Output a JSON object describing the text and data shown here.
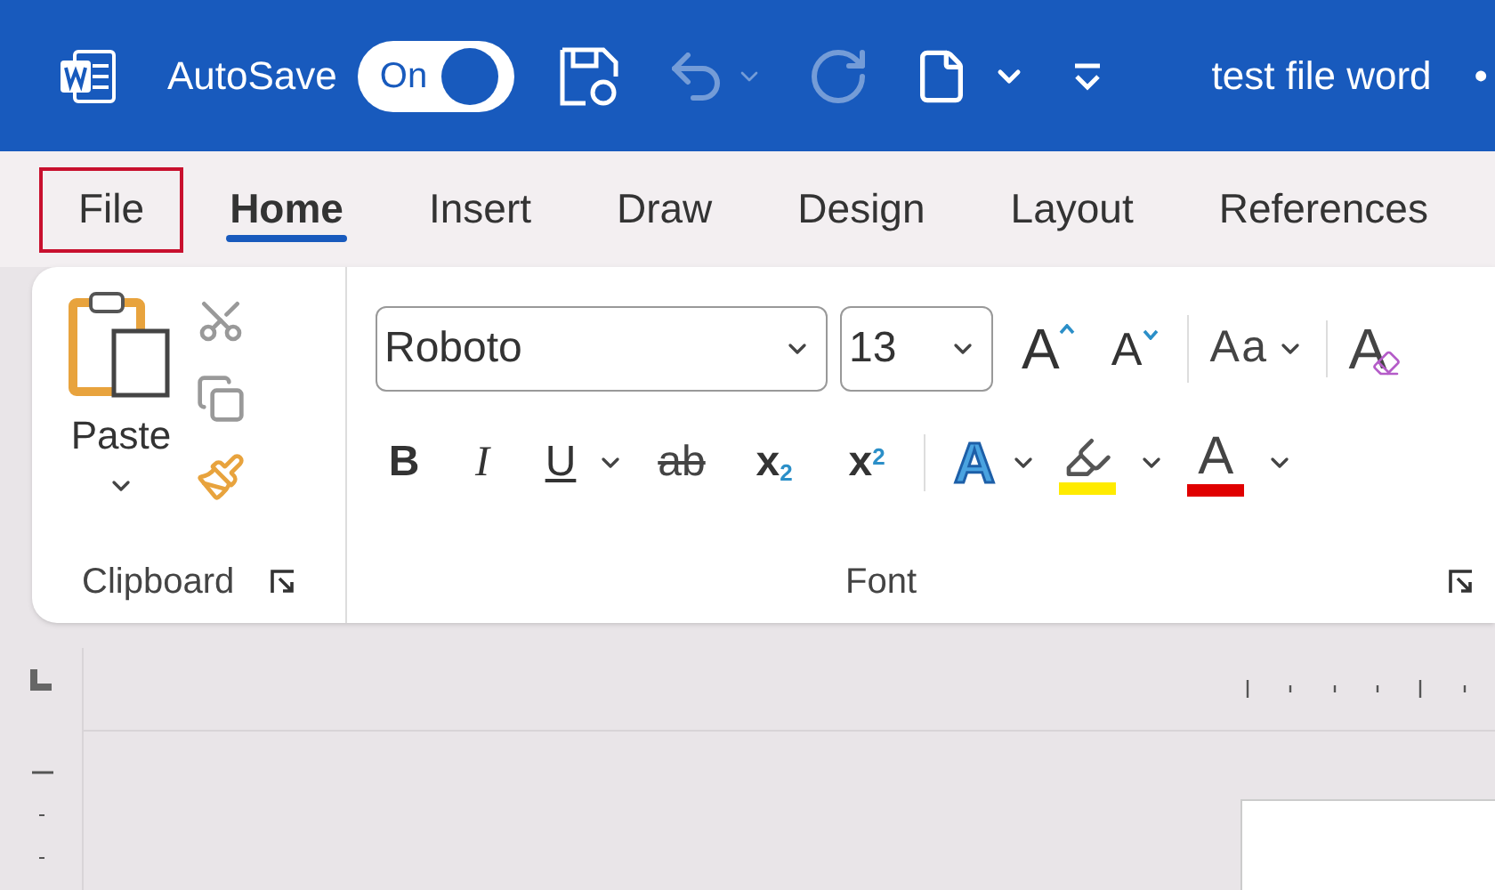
{
  "title_bar": {
    "autosave_label": "AutoSave",
    "autosave_on": true,
    "autosave_state": "On",
    "document_title": "test file word",
    "status_mark": "•"
  },
  "tabs": [
    {
      "label": "File",
      "selected": false,
      "highlighted": true
    },
    {
      "label": "Home",
      "selected": true,
      "highlighted": false
    },
    {
      "label": "Insert",
      "selected": false,
      "highlighted": false
    },
    {
      "label": "Draw",
      "selected": false,
      "highlighted": false
    },
    {
      "label": "Design",
      "selected": false,
      "highlighted": false
    },
    {
      "label": "Layout",
      "selected": false,
      "highlighted": false
    },
    {
      "label": "References",
      "selected": false,
      "highlighted": false
    }
  ],
  "clipboard": {
    "paste_label": "Paste",
    "group_label": "Clipboard"
  },
  "font": {
    "font_name": "Roboto",
    "font_size": "13",
    "group_label": "Font",
    "row_1": [
      {
        "kind": "grow",
        "label": "A"
      },
      {
        "kind": "shrink",
        "label": "A"
      },
      {
        "kind": "case",
        "label": "Aa"
      },
      {
        "kind": "clear",
        "label": "A"
      }
    ],
    "row_2": [
      {
        "kind": "bold",
        "label": "B"
      },
      {
        "kind": "italic",
        "label": "I"
      },
      {
        "kind": "underline",
        "label": "U"
      },
      {
        "kind": "strike",
        "label": "ab"
      },
      {
        "kind": "subscript",
        "label": "x$_{2}$"
      },
      {
        "kind": "superscript",
        "label": "x$^{2}$"
      },
      {
        "kind": "effects",
        "label": "A"
      },
      {
        "kind": "highlight",
        "color": "#ffeb00"
      },
      {
        "kind": "fontcolor",
        "label": "A",
        "color": "#e00000"
      }
    ]
  }
}
